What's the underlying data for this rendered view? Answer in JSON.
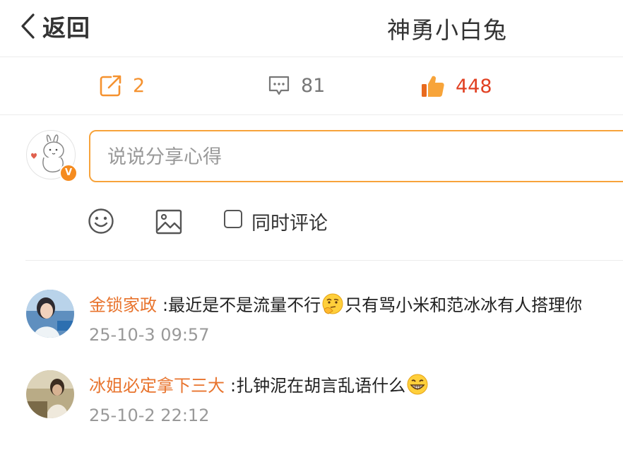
{
  "header": {
    "back_label": "返回",
    "title": "神勇小白兔"
  },
  "stats": {
    "reposts": "2",
    "comments": "81",
    "likes": "448"
  },
  "composer": {
    "placeholder": "说说分享心得",
    "also_comment_label": "同时评论",
    "badge": "V"
  },
  "comments": [
    {
      "user": "金锁家政",
      "text_before": ":最近是不是流量不行",
      "emoji": "thinking-emoji",
      "text_after": "只有骂小米和范冰冰有人搭理你",
      "time": "25-10-3 09:57"
    },
    {
      "user": "冰姐必定拿下三大",
      "text_before": ":扎钟泥在胡言乱语什么",
      "emoji": "grin-emoji",
      "text_after": "",
      "time": "25-10-2 22:12"
    }
  ],
  "colors": {
    "accent": "#f5922f",
    "like": "#e14123",
    "username": "#e8742e",
    "input_border": "#f7a33b"
  }
}
